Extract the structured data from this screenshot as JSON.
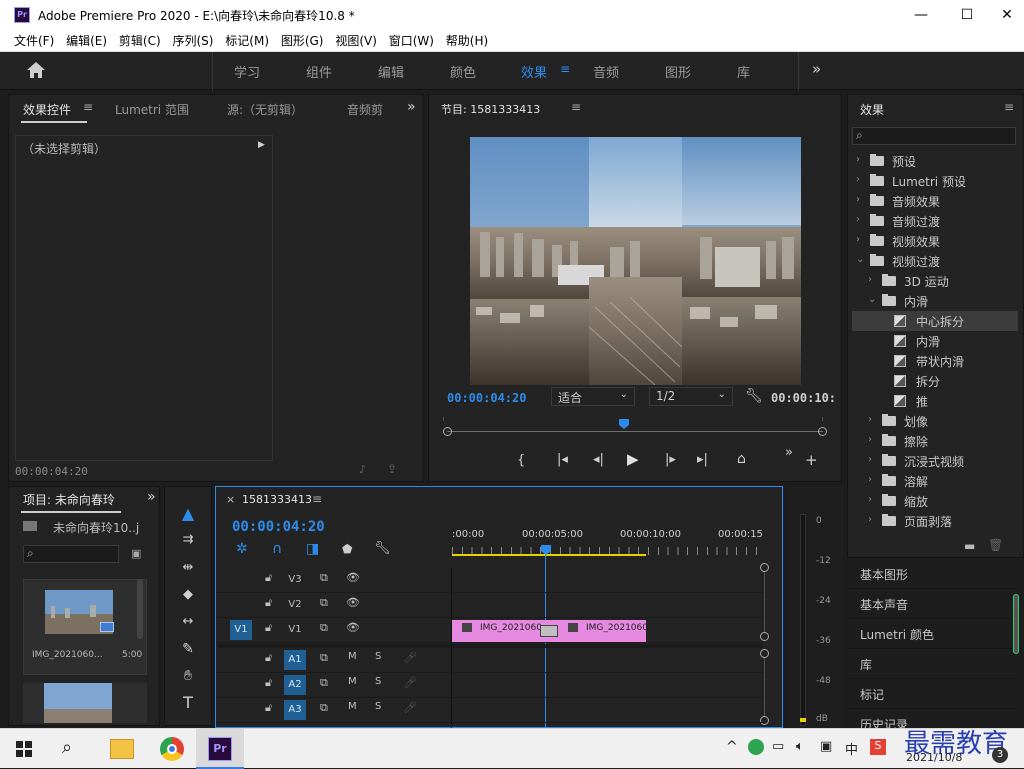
{
  "titlebar": {
    "logo": "Pr",
    "title": "Adobe Premiere Pro 2020 - E:\\向春玲\\未命向春玲10.8 *",
    "min": "—",
    "max": "☐",
    "close": "✕"
  },
  "menu": [
    "文件(F)",
    "编辑(E)",
    "剪辑(C)",
    "序列(S)",
    "标记(M)",
    "图形(G)",
    "视图(V)",
    "窗口(W)",
    "帮助(H)"
  ],
  "workspace": {
    "tabs": [
      "学习",
      "组件",
      "编辑",
      "颜色",
      "效果",
      "音频",
      "图形",
      "库"
    ],
    "active": "效果",
    "more": "»"
  },
  "effects_controls": {
    "tab": "效果控件",
    "tab2": "Lumetri 范围",
    "tab3": "源:（无剪辑）",
    "tab4": "音频剪",
    "no_clip": "（未选择剪辑）",
    "timecode": "00:00:04:20"
  },
  "program": {
    "title": "节目: 1581333413",
    "timecode": "00:00:04:20",
    "fit": "适合",
    "res": "1/2",
    "duration": "00:00:10:"
  },
  "effects": {
    "title": "效果",
    "tree": [
      {
        "label": "预设",
        "depth": 0,
        "open": false,
        "kind": "folder"
      },
      {
        "label": "Lumetri 预设",
        "depth": 0,
        "open": false,
        "kind": "folder"
      },
      {
        "label": "音频效果",
        "depth": 0,
        "open": false,
        "kind": "folder"
      },
      {
        "label": "音频过渡",
        "depth": 0,
        "open": false,
        "kind": "folder"
      },
      {
        "label": "视频效果",
        "depth": 0,
        "open": false,
        "kind": "folder"
      },
      {
        "label": "视频过渡",
        "depth": 0,
        "open": true,
        "kind": "folder"
      },
      {
        "label": "3D 运动",
        "depth": 1,
        "open": false,
        "kind": "folder"
      },
      {
        "label": "内滑",
        "depth": 1,
        "open": true,
        "kind": "folder"
      },
      {
        "label": "中心拆分",
        "depth": 2,
        "kind": "fx",
        "selected": true
      },
      {
        "label": "内滑",
        "depth": 2,
        "kind": "fx"
      },
      {
        "label": "带状内滑",
        "depth": 2,
        "kind": "fx"
      },
      {
        "label": "拆分",
        "depth": 2,
        "kind": "fx"
      },
      {
        "label": "推",
        "depth": 2,
        "kind": "fx"
      },
      {
        "label": "划像",
        "depth": 1,
        "open": false,
        "kind": "folder"
      },
      {
        "label": "擦除",
        "depth": 1,
        "open": false,
        "kind": "folder"
      },
      {
        "label": "沉浸式视频",
        "depth": 1,
        "open": false,
        "kind": "folder"
      },
      {
        "label": "溶解",
        "depth": 1,
        "open": false,
        "kind": "folder"
      },
      {
        "label": "缩放",
        "depth": 1,
        "open": false,
        "kind": "folder"
      },
      {
        "label": "页面剥落",
        "depth": 1,
        "open": false,
        "kind": "folder"
      }
    ],
    "links": [
      "基本图形",
      "基本声音",
      "Lumetri 颜色",
      "库",
      "标记",
      "历史记录"
    ]
  },
  "project": {
    "title": "项目: 未命向春玲",
    "file": "未命向春玲10..j",
    "clip_name": "IMG_2021060...",
    "clip_dur": "5:00"
  },
  "timeline": {
    "title": "1581333413",
    "timecode": "00:00:04:20",
    "ruler": [
      ":00:00",
      "00:00:05:00",
      "00:00:10:00",
      "00:00:15"
    ],
    "tracks": [
      {
        "name": "V3",
        "src": ""
      },
      {
        "name": "V2",
        "src": ""
      },
      {
        "name": "V1",
        "src": "V1"
      },
      {
        "name": "A1",
        "src": ""
      },
      {
        "name": "A2",
        "src": ""
      },
      {
        "name": "A3",
        "src": ""
      }
    ],
    "clips": [
      "IMG_2021060",
      "IMG_2021060"
    ],
    "m": "M",
    "s": "S"
  },
  "meter": [
    "0",
    "-12",
    "-24",
    "-36",
    "-48",
    "dB"
  ],
  "taskbar": {
    "date": "2021/10/8",
    "ime": "中",
    "badge": "3",
    "watermark": "最需教育"
  }
}
